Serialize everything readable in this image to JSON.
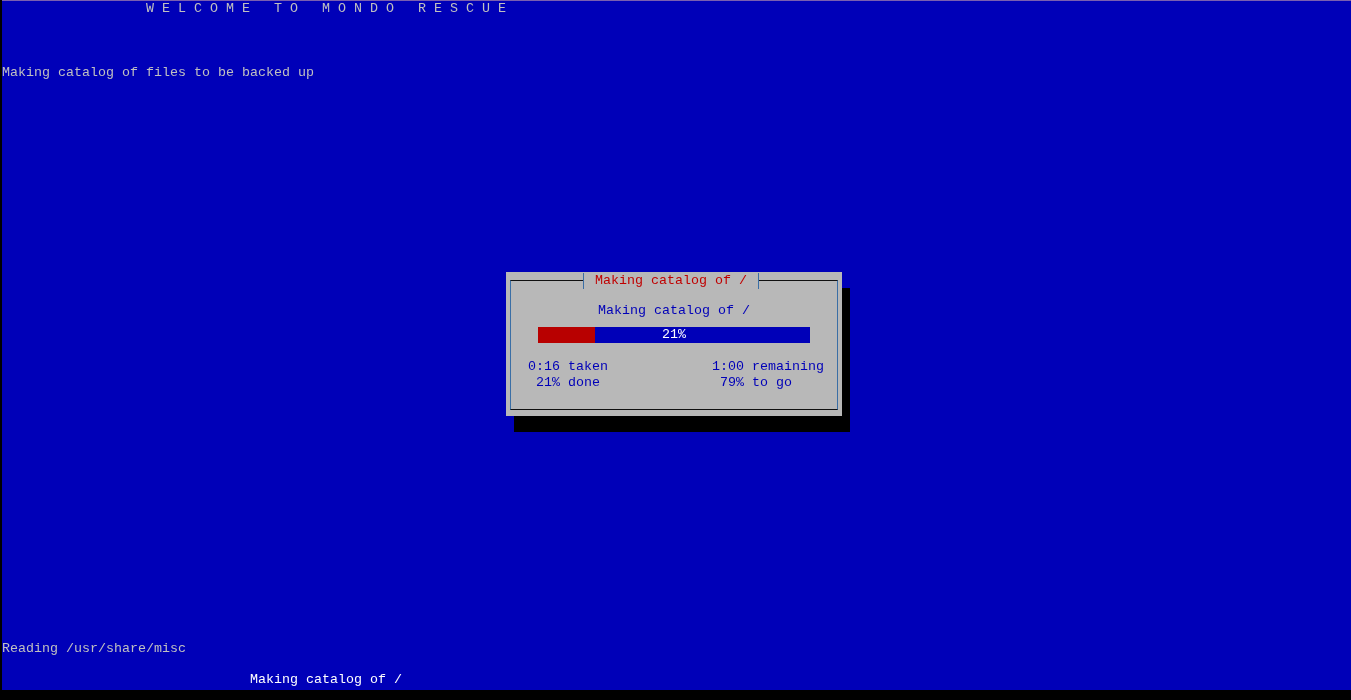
{
  "screen": {
    "title": "W E L C O M E   T O   M O N D O   R E S C U E",
    "status_line": "Making catalog of files to be backed up",
    "log_line": "Reading /usr/share/misc",
    "bottom_line": "Making catalog of /"
  },
  "dialog": {
    "title": "Making catalog of /",
    "message": "Making catalog of /",
    "progress": {
      "level": 0.21,
      "label": "21%"
    },
    "stats": [
      {
        "left": "0:16 taken",
        "right": "1:00 remaining"
      },
      {
        "left": "21% done",
        "right": "79% to go"
      }
    ]
  }
}
